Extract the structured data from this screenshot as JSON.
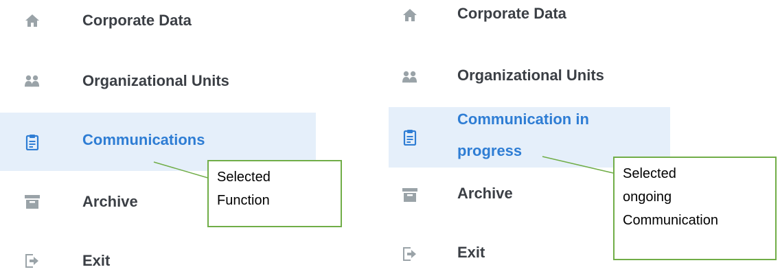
{
  "left_menu": {
    "items": [
      {
        "label": "Corporate Data",
        "icon": "home-icon"
      },
      {
        "label": "Organizational Units",
        "icon": "users-icon"
      },
      {
        "label": "Communications",
        "icon": "clipboard-icon",
        "selected": true
      },
      {
        "label": "Archive",
        "icon": "archive-icon"
      },
      {
        "label": "Exit",
        "icon": "exit-icon"
      }
    ],
    "callout": {
      "line1": "Selected",
      "line2": "Function"
    }
  },
  "right_menu": {
    "items": [
      {
        "label": "Corporate Data",
        "icon": "home-icon"
      },
      {
        "label": "Organizational Units",
        "icon": "users-icon"
      },
      {
        "label_line1": "Communication in",
        "label_line2": "progress",
        "icon": "clipboard-icon",
        "selected": true
      },
      {
        "label": "Archive",
        "icon": "archive-icon"
      },
      {
        "label": "Exit",
        "icon": "exit-icon"
      }
    ],
    "callout": {
      "line1": "Selected",
      "line2": "ongoing",
      "line3": "Communication"
    }
  },
  "colors": {
    "text": "#3b3f45",
    "selected_text": "#2e7dd4",
    "selected_bg": "#e5effa",
    "icon_gray": "#9aa3a8",
    "icon_blue": "#2e7dd4",
    "callout_border": "#70ad47"
  }
}
